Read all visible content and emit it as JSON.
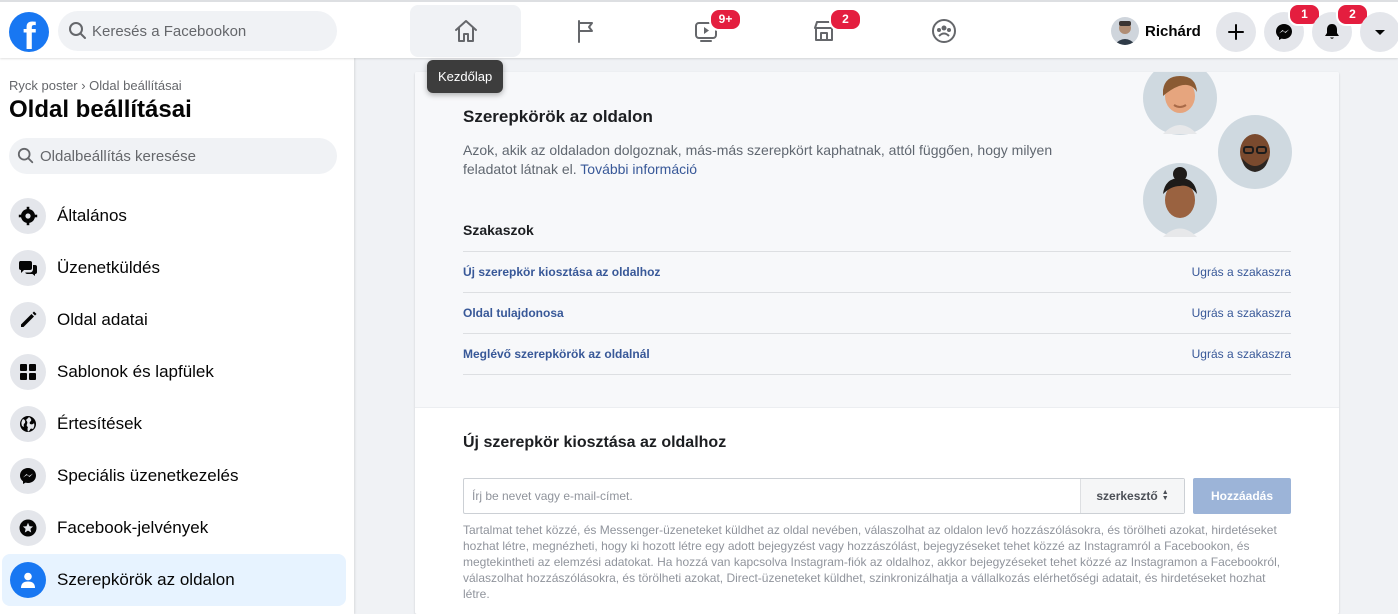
{
  "topbar": {
    "search_placeholder": "Keresés a Facebookon",
    "badges": {
      "watch": "9+",
      "marketplace": "2",
      "messenger": "1",
      "notifications": "2"
    },
    "profile_name": "Richárd",
    "tooltip": "Kezdőlap"
  },
  "sidebar": {
    "breadcrumb": "Ryck poster › Oldal beállításai",
    "title": "Oldal beállításai",
    "search_placeholder": "Oldalbeállítás keresése",
    "items": [
      {
        "label": "Általános",
        "icon": "gear-icon"
      },
      {
        "label": "Üzenetküldés",
        "icon": "chat-bubbles-icon"
      },
      {
        "label": "Oldal adatai",
        "icon": "pencil-icon"
      },
      {
        "label": "Sablonok és lapfülek",
        "icon": "grid-icon"
      },
      {
        "label": "Értesítések",
        "icon": "globe-icon"
      },
      {
        "label": "Speciális üzenetkezelés",
        "icon": "messenger-icon"
      },
      {
        "label": "Facebook-jelvények",
        "icon": "star-badge-icon"
      },
      {
        "label": "Szerepkörök az oldalon",
        "icon": "person-icon",
        "active": true
      }
    ]
  },
  "intro": {
    "title": "Szerepkörök az oldalon",
    "description": "Azok, akik az oldaladon dolgoznak, más-más szerepkört kaphatnak, attól függően, hogy milyen feladatot látnak el.",
    "more_link": "További információ",
    "sections_heading": "Szakaszok",
    "jump_label": "Ugrás a szakaszra",
    "sections": [
      "Új szerepkör kiosztása az oldalhoz",
      "Oldal tulajdonosa",
      "Meglévő szerepkörök az oldalnál"
    ]
  },
  "assign": {
    "title": "Új szerepkör kiosztása az oldalhoz",
    "input_placeholder": "Írj be nevet vagy e-mail-címet.",
    "role_value": "szerkesztő",
    "add_button": "Hozzáadás",
    "help_text": "Tartalmat tehet közzé, és Messenger-üzeneteket küldhet az oldal nevében, válaszolhat az oldalon levő hozzászólásokra, és törölheti azokat, hirdetéseket hozhat létre, megnézheti, hogy ki hozott létre egy adott bejegyzést vagy hozzászólást, bejegyzéseket tehet közzé az Instagramról a Facebookon, és megtekintheti az elemzési adatokat. Ha hozzá van kapcsolva Instagram-fiók az oldalhoz, akkor bejegyzéseket tehet közzé az Instagramon a Facebookról, válaszolhat hozzászólásokra, és törölheti azokat, Direct-üzeneteket küldhet, szinkronizálhatja a vállalkozás elérhetőségi adatait, és hirdetéseket hozhat létre."
  },
  "colors": {
    "brand": "#1877f2",
    "link": "#385898",
    "badge": "#e41e3f",
    "active_bg": "#e7f3ff"
  }
}
